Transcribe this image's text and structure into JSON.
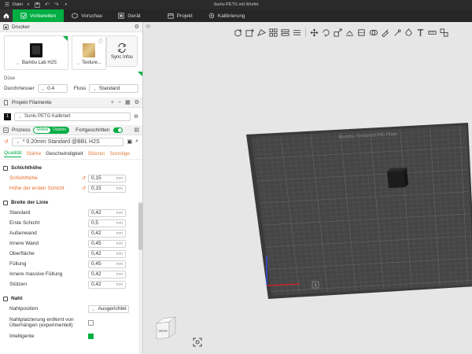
{
  "titlebar": {
    "menu_label": "Datei",
    "doc_title": "Sunlu PETG mit Würfel"
  },
  "tabs": [
    {
      "label": "Vorbereiten",
      "active": true
    },
    {
      "label": "Vorschau"
    },
    {
      "label": "Gerät"
    },
    {
      "label": "Projekt"
    },
    {
      "label": "Kalibrierung"
    }
  ],
  "printer": {
    "section_title": "Drucker",
    "printer_name": "Bambu Lab H2S",
    "plate_name": "Texture...",
    "sync_label": "Sync Infos"
  },
  "nozzle": {
    "label": "Düse",
    "diameter_label": "Durchmesser",
    "diameter_value": "0.4",
    "flow_label": "Fluss",
    "flow_value": "Standard"
  },
  "filaments": {
    "section_title": "Projekt Filamente",
    "items": [
      {
        "num": "1",
        "name": "Sunlu PETG Kalibriert"
      }
    ]
  },
  "process": {
    "section_title": "Prozess",
    "toggle_global": "Global",
    "toggle_object": "Objekte",
    "advanced_label": "Fortgeschritten",
    "preset": "* 0.20mm Standard @BBL H2S"
  },
  "subtabs": [
    "Qualität",
    "Stärke",
    "Geschwindigkeit",
    "Stützen",
    "Sonstige"
  ],
  "groups": {
    "layer_height": {
      "title": "Schichthöhe",
      "rows": [
        {
          "label": "Schichthöhe",
          "value": "0,15",
          "unit": "mm"
        },
        {
          "label": "Höhe der ersten Schicht",
          "value": "0,15",
          "unit": "mm"
        }
      ]
    },
    "line_width": {
      "title": "Breite der Linie",
      "rows": [
        {
          "label": "Standard",
          "value": "0,42",
          "unit": "mm"
        },
        {
          "label": "Erste Schicht",
          "value": "0,5",
          "unit": "mm"
        },
        {
          "label": "Außenwand",
          "value": "0,42",
          "unit": "mm"
        },
        {
          "label": "Innere Wand",
          "value": "0,45",
          "unit": "mm"
        },
        {
          "label": "Oberfläche",
          "value": "0,42",
          "unit": "mm"
        },
        {
          "label": "Füllung",
          "value": "0,45",
          "unit": "mm"
        },
        {
          "label": "Innere massive Füllung",
          "value": "0,42",
          "unit": "mm"
        },
        {
          "label": "Stützen",
          "value": "0,42",
          "unit": "mm"
        }
      ]
    },
    "seam": {
      "title": "Naht",
      "position_label": "Nahtposition",
      "position_value": "Ausgerichtet",
      "overhang_label": "Nahtplatzierung entfernt von Überhängen (experimentell)",
      "smart_label": "Intelligente"
    }
  },
  "viewport": {
    "plate_label": "Bambu Textured PEI Plate",
    "plate_number": "1",
    "navcube_label": "Vorne"
  },
  "colors": {
    "accent": "#00ae42",
    "modified": "#e86c2a"
  }
}
